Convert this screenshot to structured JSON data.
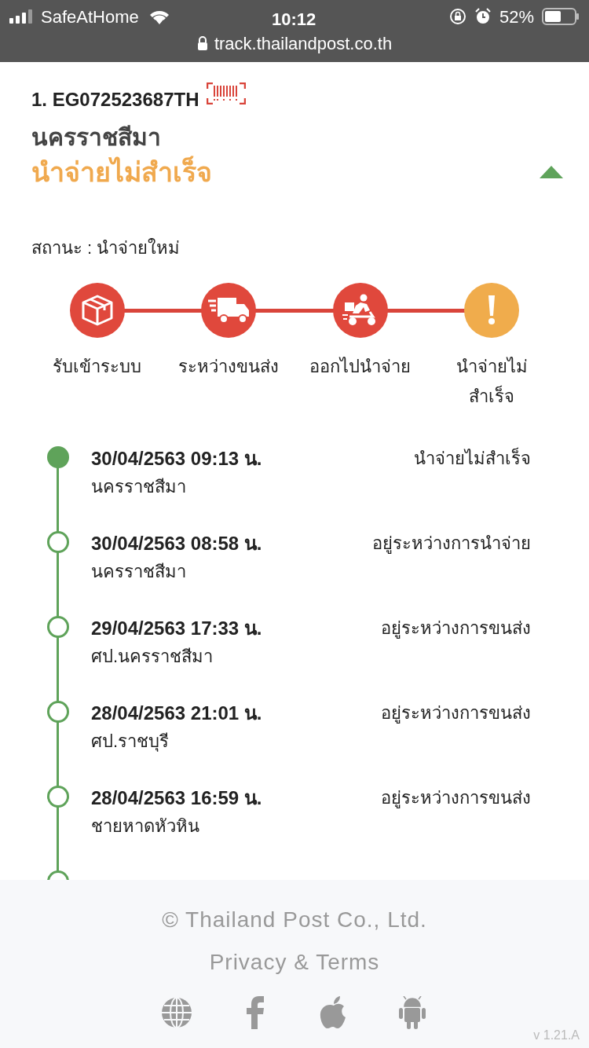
{
  "status_bar": {
    "carrier": "SafeAtHome",
    "time": "10:12",
    "battery": "52%"
  },
  "address_bar": {
    "url": "track.thailandpost.co.th"
  },
  "parcel": {
    "number": "1. EG072523687TH",
    "location": "นครราชสีมา",
    "status": "นำจ่ายไม่สำเร็จ",
    "expanded": true,
    "status_line": "สถานะ : นำจ่ายใหม่"
  },
  "steps": [
    {
      "kind": "box",
      "label": "รับเข้าระบบ",
      "color": "#e0483c"
    },
    {
      "kind": "truck",
      "label": "ระหว่างขนส่ง",
      "color": "#e0483c"
    },
    {
      "kind": "scooter",
      "label": "ออกไปนำจ่าย",
      "color": "#e0483c"
    },
    {
      "kind": "alert",
      "label": "นำจ่ายไม่สำเร็จ",
      "color": "#f0ac4c"
    }
  ],
  "events": [
    {
      "datetime": "30/04/2563 09:13 น.",
      "status": "นำจ่ายไม่สำเร็จ",
      "place": "นครราชสีมา",
      "selected": true
    },
    {
      "datetime": "30/04/2563 08:58 น.",
      "status": "อยู่ระหว่างการนำจ่าย",
      "place": "นครราชสีมา",
      "selected": false
    },
    {
      "datetime": "29/04/2563 17:33 น.",
      "status": "อยู่ระหว่างการขนส่ง",
      "place": "ศป.นครราชสีมา",
      "selected": false
    },
    {
      "datetime": "28/04/2563 21:01 น.",
      "status": "อยู่ระหว่างการขนส่ง",
      "place": "ศป.ราชบุรี",
      "selected": false
    },
    {
      "datetime": "28/04/2563 16:59 น.",
      "status": "อยู่ระหว่างการขนส่ง",
      "place": "ชายหาดหัวหิน",
      "selected": false
    }
  ],
  "footer": {
    "copyright": "© Thailand Post Co., Ltd.",
    "links": "Privacy & Terms",
    "icons": [
      {
        "kind": "globe"
      },
      {
        "kind": "facebook"
      },
      {
        "kind": "apple"
      },
      {
        "kind": "android"
      }
    ],
    "version": "v 1.21.A"
  }
}
